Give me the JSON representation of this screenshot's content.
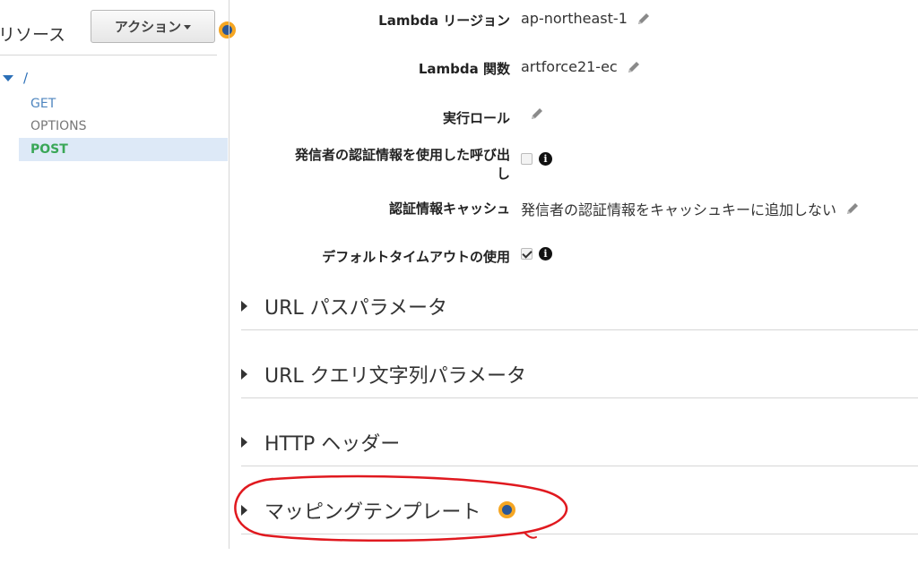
{
  "sidebar": {
    "title": "リソース",
    "actions_label": "アクション",
    "tree": {
      "root": "/",
      "methods": [
        {
          "label": "GET"
        },
        {
          "label": "OPTIONS"
        },
        {
          "label": "POST",
          "selected": true
        }
      ]
    }
  },
  "settings": {
    "lambda_region": {
      "label": "Lambda リージョン",
      "value": "ap-northeast-1"
    },
    "lambda_function": {
      "label": "Lambda 関数",
      "value": "artforce21-ec"
    },
    "execution_role": {
      "label": "実行ロール",
      "value": ""
    },
    "invoke_with_caller_credentials": {
      "label_line1": "発信者の認証情報を使用した呼び出",
      "label_line2": "し",
      "checked": false
    },
    "credentials_cache": {
      "label": "認証情報キャッシュ",
      "value": "発信者の認証情報をキャッシュキーに追加しない"
    },
    "use_default_timeout": {
      "label": "デフォルトタイムアウトの使用",
      "checked": true
    }
  },
  "sections": [
    {
      "label": "URL パスパラメータ"
    },
    {
      "label": "URL クエリ文字列パラメータ"
    },
    {
      "label": "HTTP ヘッダー"
    },
    {
      "label": "マッピングテンプレート"
    }
  ],
  "colors": {
    "accent_link": "#2b6fb7",
    "selected_method": "#3aa757",
    "selected_bg": "#dde9f7",
    "annotation": "#e0191f",
    "marker_orange": "#f5a623"
  }
}
